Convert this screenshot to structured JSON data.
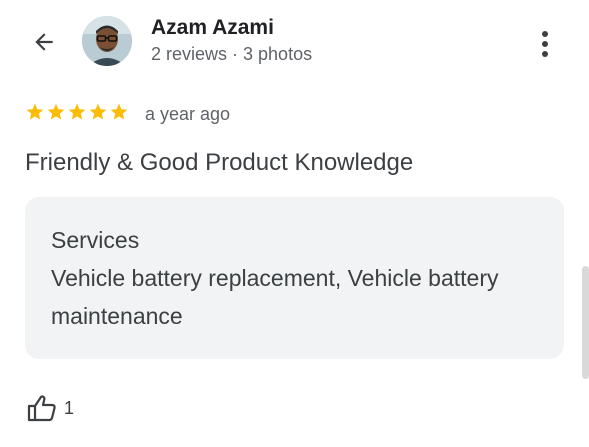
{
  "header": {
    "back_icon": "arrow-back-icon",
    "reviewer_name": "Azam Azami",
    "reviewer_meta": "2 reviews · 3 photos",
    "more_icon": "more-vert-icon"
  },
  "review": {
    "rating": 5,
    "rating_max": 5,
    "star_color": "#fbbc04",
    "time_ago": "a year ago",
    "text": "Friendly & Good Product Knowledge"
  },
  "services": {
    "title": "Services",
    "text": "Vehicle battery replacement, Vehicle battery maintenance"
  },
  "actions": {
    "like_icon": "thumb-up-icon",
    "like_count": "1"
  }
}
